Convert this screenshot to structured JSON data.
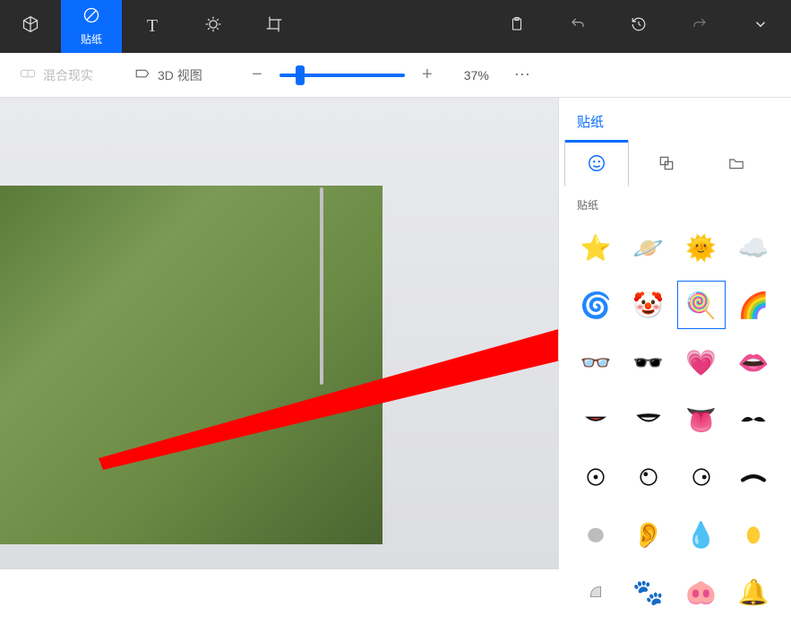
{
  "topbar": {
    "item_3d": "3D",
    "item_sticker": "贴纸",
    "item_text": "T",
    "item_effects": "✦",
    "item_crop": "▦"
  },
  "subbar": {
    "mixed_reality": "混合现实",
    "view_3d": "3D 视图",
    "zoom_value": "37%"
  },
  "panel": {
    "title": "贴纸",
    "section_label": "贴纸",
    "tabs": {
      "face": "☺",
      "custom": "⎘",
      "folder": "🗀"
    },
    "stickers": [
      {
        "id": "star",
        "glyph": "⭐"
      },
      {
        "id": "planet",
        "glyph": "🪐"
      },
      {
        "id": "sun",
        "glyph": "🌞"
      },
      {
        "id": "cloud",
        "glyph": "☁️"
      },
      {
        "id": "spiral",
        "glyph": "🌀"
      },
      {
        "id": "clown",
        "glyph": "🤡"
      },
      {
        "id": "lollipop",
        "glyph": "🍭"
      },
      {
        "id": "rainbow",
        "glyph": "🌈"
      },
      {
        "id": "eyeglasses",
        "glyph": "👓"
      },
      {
        "id": "sunglasses",
        "glyph": "🕶️"
      },
      {
        "id": "heart",
        "glyph": "💗"
      },
      {
        "id": "lips",
        "glyph": "👄"
      },
      {
        "id": "mouth1",
        "svg": "mouth-flat"
      },
      {
        "id": "mouth2",
        "svg": "mouth-smile"
      },
      {
        "id": "tongue",
        "glyph": "👅"
      },
      {
        "id": "mustache",
        "svg": "mustache"
      },
      {
        "id": "eye1",
        "svg": "eye-dot-center"
      },
      {
        "id": "eye2",
        "svg": "eye-dot-left"
      },
      {
        "id": "eye3",
        "svg": "eye-dot-right"
      },
      {
        "id": "brow",
        "svg": "brow"
      },
      {
        "id": "blob-gray",
        "svg": "blob-gray"
      },
      {
        "id": "ear",
        "glyph": "👂"
      },
      {
        "id": "drop",
        "glyph": "💧"
      },
      {
        "id": "blob-yellow",
        "svg": "blob-yellow"
      },
      {
        "id": "shape1",
        "svg": "shape-a"
      },
      {
        "id": "paws",
        "glyph": "🐾"
      },
      {
        "id": "snout",
        "glyph": "🐽"
      },
      {
        "id": "bell",
        "glyph": "🔔"
      }
    ],
    "selected_index": 6
  }
}
